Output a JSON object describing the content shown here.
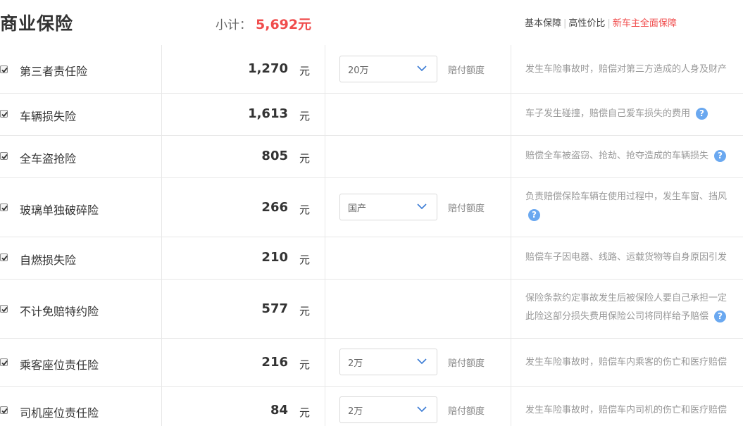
{
  "header": {
    "title": "商业保险",
    "subtotal_label": "小计：",
    "subtotal_value": "5,692元",
    "links": [
      "基本保障",
      "高性价比",
      "新车主全面保障"
    ]
  },
  "unit": "元",
  "amount_label": "赔付额度",
  "rows": [
    {
      "name": "第三者责任险",
      "price": "1,270",
      "select": "20万",
      "desc1": "发生车险事故时，赔偿对第三方造成的人身及财产",
      "desc2": ""
    },
    {
      "name": "车辆损失险",
      "price": "1,613",
      "select": "",
      "desc1": "车子发生碰撞，赔偿自己爱车损失的费用",
      "desc2": ""
    },
    {
      "name": "全车盗抢险",
      "price": "805",
      "select": "",
      "desc1": "赔偿全车被盗窃、抢劫、抢夺造成的车辆损失",
      "desc2": ""
    },
    {
      "name": "玻璃单独破碎险",
      "price": "266",
      "select": "国产",
      "desc1": "负责赔偿保险车辆在使用过程中，发生车窗、挡风",
      "desc2": ""
    },
    {
      "name": "自燃损失险",
      "price": "210",
      "select": "",
      "desc1": "赔偿车子因电器、线路、运载货物等自身原因引发",
      "desc2": ""
    },
    {
      "name": "不计免赔特约险",
      "price": "577",
      "select": "",
      "desc1": "保险条款约定事故发生后被保险人要自己承担一定",
      "desc2": "此险这部分损失费用保险公司将同样给予赔偿"
    },
    {
      "name": "乘客座位责任险",
      "price": "216",
      "select": "2万",
      "desc1": "发生车险事故时，赔偿车内乘客的伤亡和医疗赔偿",
      "desc2": ""
    },
    {
      "name": "司机座位责任险",
      "price": "84",
      "select": "2万",
      "desc1": "发生车险事故时，赔偿车内司机的伤亡和医疗赔偿",
      "desc2": ""
    }
  ],
  "help_glyph": "?"
}
